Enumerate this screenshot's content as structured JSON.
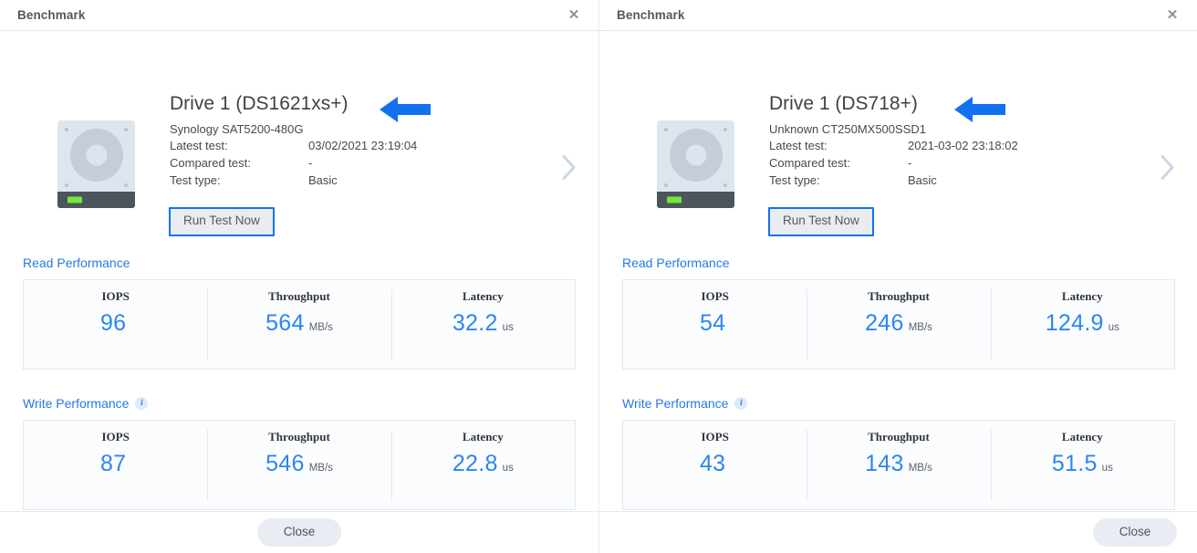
{
  "accent_color": "#2579e3",
  "value_color": "#2c86f0",
  "annotation_arrow_color": "#1271f0",
  "led_color": "#76e637",
  "labels": {
    "model_row": "",
    "latest_test": "Latest test:",
    "compared_test": "Compared test:",
    "test_type": "Test type:",
    "run_test": "Run Test Now",
    "read_performance": "Read Performance",
    "write_performance": "Write Performance",
    "iops": "IOPS",
    "throughput": "Throughput",
    "latency": "Latency",
    "unit_mbs": "MB/s",
    "unit_us": "us",
    "close": "Close",
    "close_x": "✕",
    "info_glyph": "i"
  },
  "windows": [
    {
      "title": "Benchmark",
      "drive": {
        "title": "Drive 1 (DS1621xs+)",
        "model": "Synology SAT5200-480G",
        "latest_test": "03/02/2021 23:19:04",
        "compared_test": "-",
        "test_type": "Basic",
        "run_test_label": "Run Test Now",
        "icon": "hard-drive-icon"
      },
      "annotation": {
        "icon": "left-arrow-annotation",
        "color": "#1271f0"
      },
      "next_icon": "chevron-right-icon",
      "read": {
        "heading": "Read Performance",
        "has_info_icon": false,
        "metrics": [
          {
            "label": "IOPS",
            "value": "96",
            "unit": ""
          },
          {
            "label": "Throughput",
            "value": "564",
            "unit": "MB/s"
          },
          {
            "label": "Latency",
            "value": "32.2",
            "unit": "us"
          }
        ]
      },
      "write": {
        "heading": "Write Performance",
        "has_info_icon": true,
        "metrics": [
          {
            "label": "IOPS",
            "value": "87",
            "unit": ""
          },
          {
            "label": "Throughput",
            "value": "546",
            "unit": "MB/s"
          },
          {
            "label": "Latency",
            "value": "22.8",
            "unit": "us"
          }
        ]
      },
      "footer_button": "Close"
    },
    {
      "title": "Benchmark",
      "drive": {
        "title": "Drive 1 (DS718+)",
        "model": "Unknown CT250MX500SSD1",
        "latest_test": "2021-03-02 23:18:02",
        "compared_test": "-",
        "test_type": "Basic",
        "run_test_label": "Run Test Now",
        "icon": "hard-drive-icon"
      },
      "annotation": {
        "icon": "left-arrow-annotation",
        "color": "#1271f0"
      },
      "next_icon": "chevron-right-icon",
      "read": {
        "heading": "Read Performance",
        "has_info_icon": false,
        "metrics": [
          {
            "label": "IOPS",
            "value": "54",
            "unit": ""
          },
          {
            "label": "Throughput",
            "value": "246",
            "unit": "MB/s"
          },
          {
            "label": "Latency",
            "value": "124.9",
            "unit": "us"
          }
        ]
      },
      "write": {
        "heading": "Write Performance",
        "has_info_icon": true,
        "metrics": [
          {
            "label": "IOPS",
            "value": "43",
            "unit": ""
          },
          {
            "label": "Throughput",
            "value": "143",
            "unit": "MB/s"
          },
          {
            "label": "Latency",
            "value": "51.5",
            "unit": "us"
          }
        ]
      },
      "footer_button": "Close"
    }
  ]
}
